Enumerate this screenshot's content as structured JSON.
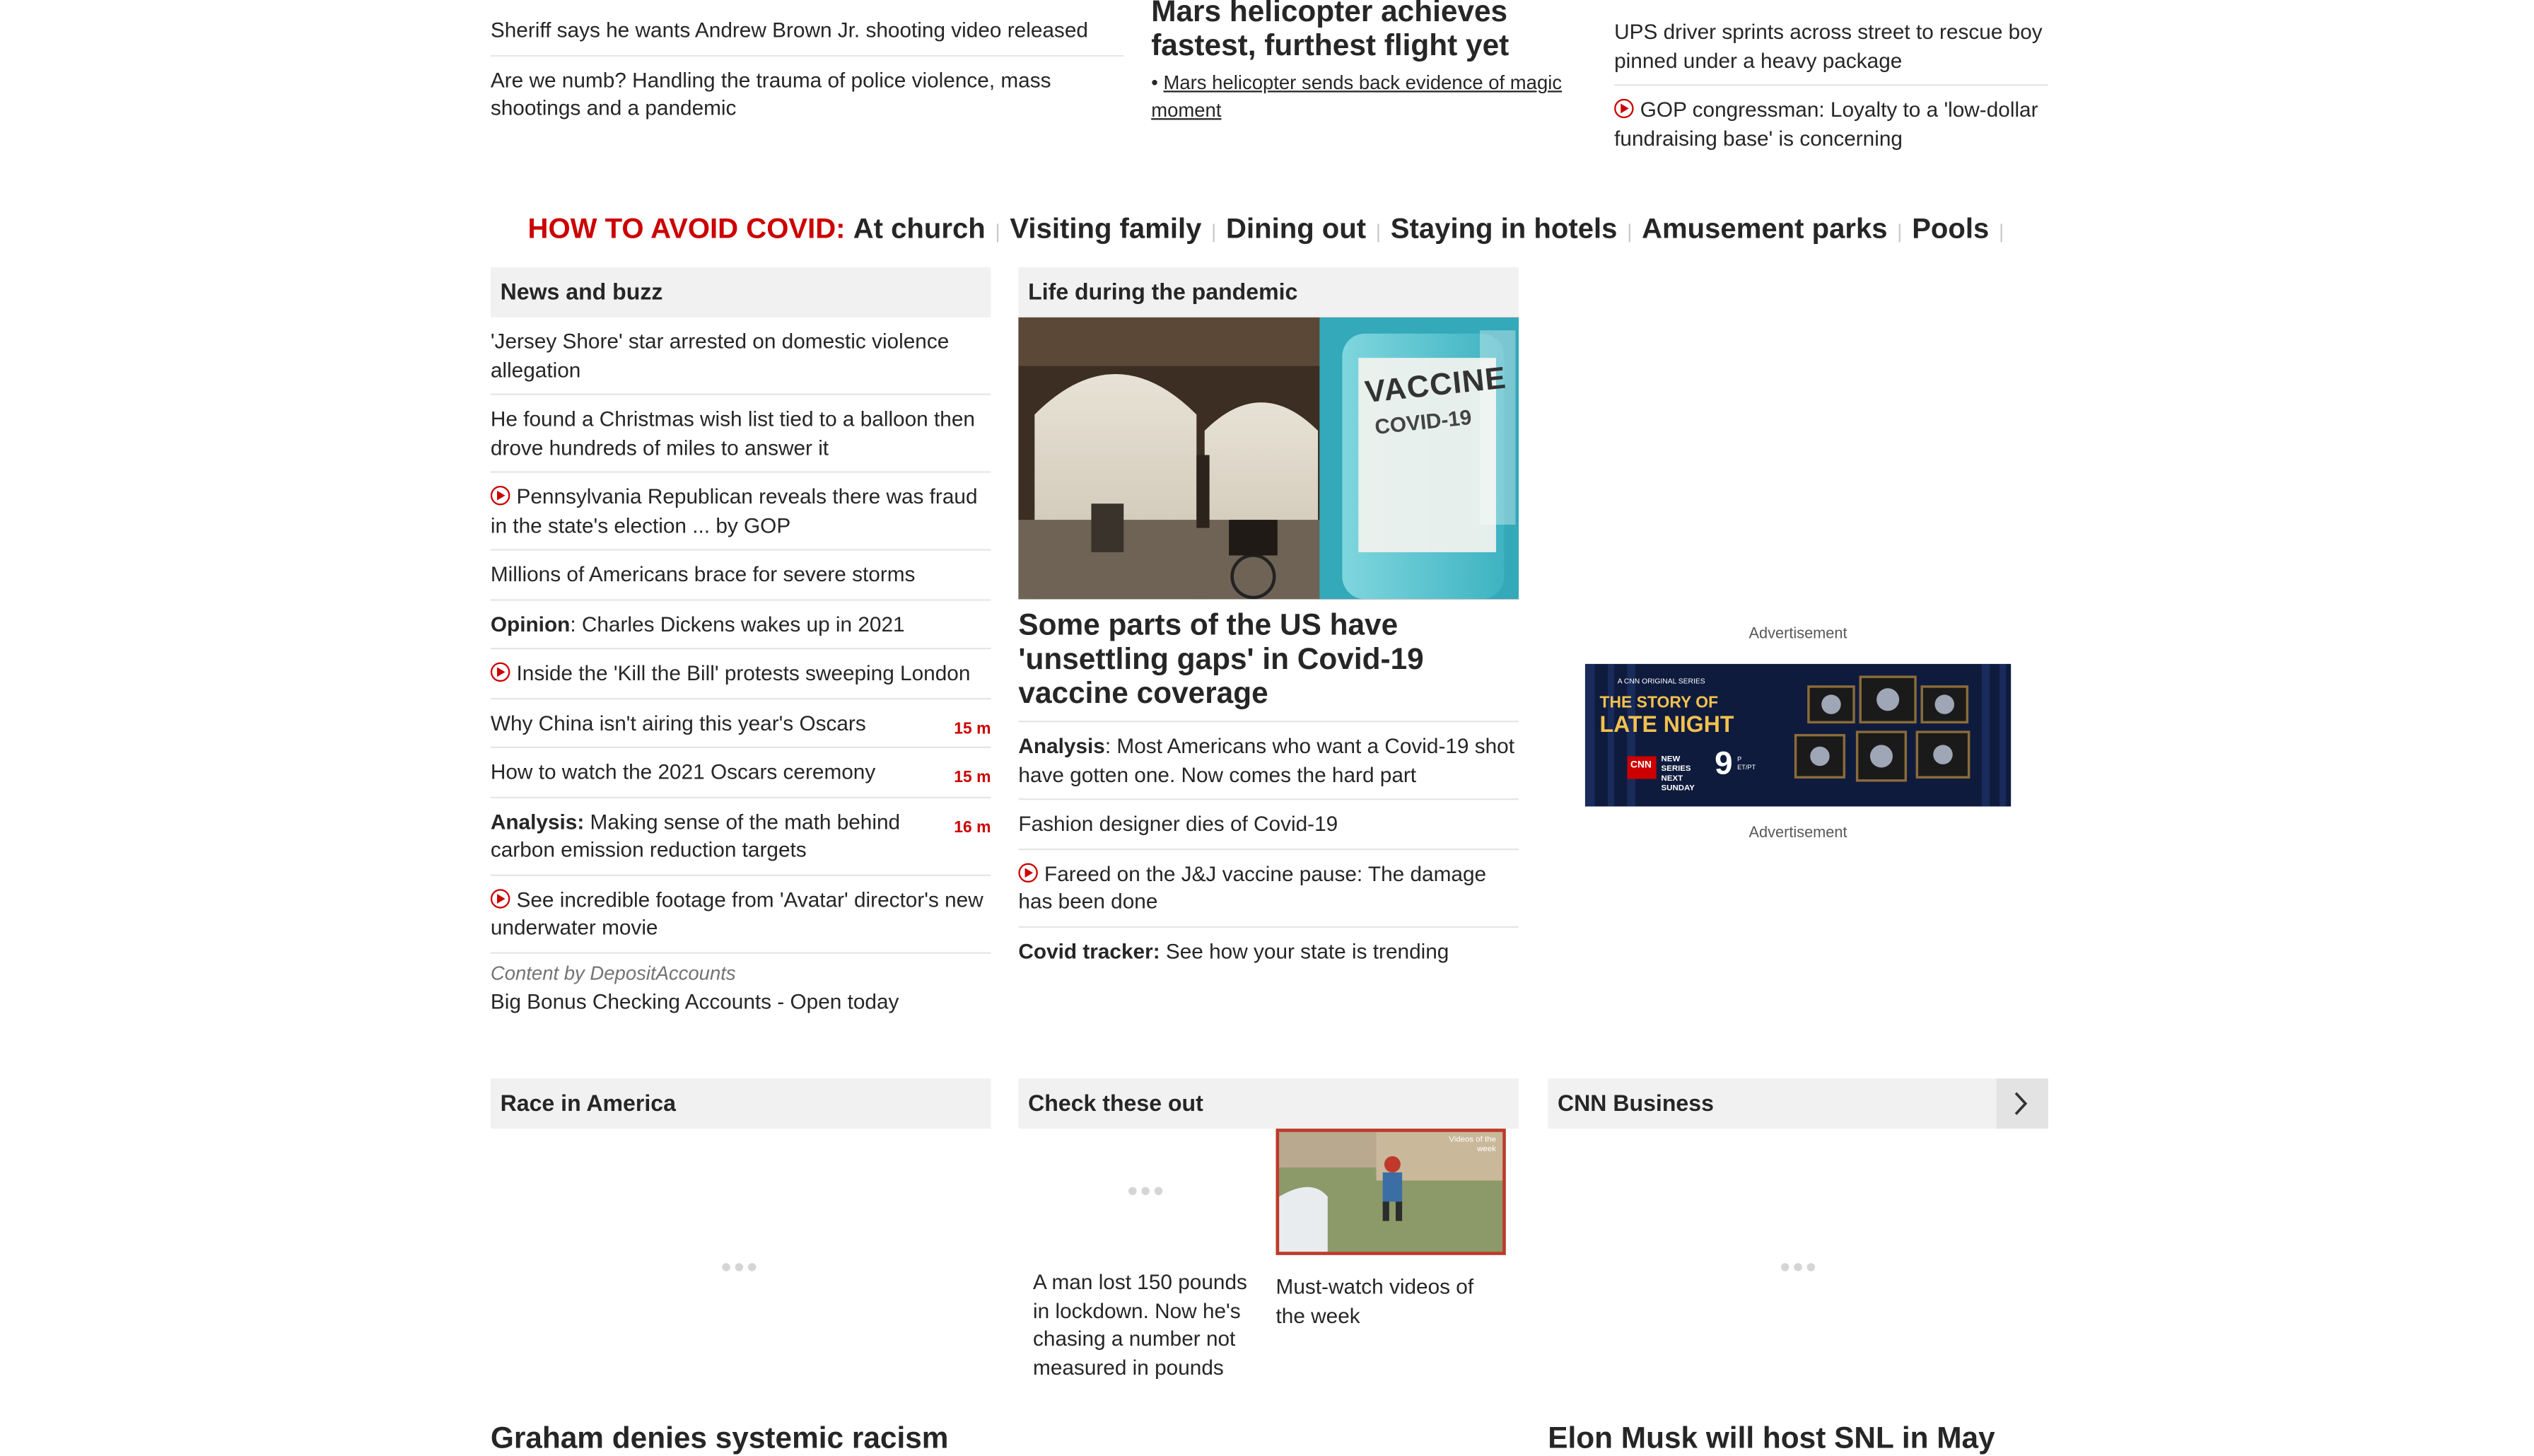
{
  "top_left": [
    "Sheriff says he wants Andrew Brown Jr. shooting video released",
    "Are we numb? Handling the trauma of police violence, mass shootings and a pandemic"
  ],
  "top_middle": {
    "headline": "Mars helicopter achieves fastest, furthest flight yet",
    "sub": "Mars helicopter sends back evidence of magic moment"
  },
  "top_right": [
    "UPS driver sprints across street to rescue boy pinned under a heavy package",
    "GOP congressman: Loyalty to a 'low-dollar fundraising base' is concerning"
  ],
  "covid_bar": {
    "label": "HOW TO AVOID COVID:",
    "items": [
      "At church",
      "Visiting family",
      "Dining out",
      "Staying in hotels",
      "Amusement parks",
      "Pools"
    ]
  },
  "news_buzz": {
    "title": "News and buzz",
    "items": [
      {
        "text": "'Jersey Shore' star arrested on domestic violence allegation"
      },
      {
        "text": "He found a Christmas wish list tied to a balloon then drove hundreds of miles to answer it"
      },
      {
        "text": "Pennsylvania Republican reveals there was fraud in the state's election ... by GOP"
      },
      {
        "text": "Millions of Americans brace for severe storms"
      },
      {
        "prefix": "Opinion",
        "text": ": Charles Dickens wakes up in 2021"
      },
      {
        "text": "Inside the 'Kill the Bill' protests sweeping London"
      },
      {
        "text": "Why China isn't airing this year's Oscars",
        "time": "15 m"
      },
      {
        "text": "How to watch the 2021 Oscars ceremony",
        "time": "15 m"
      },
      {
        "prefix": "Analysis:",
        "text": " Making sense of the math behind carbon emission reduction targets",
        "time": "16 m"
      },
      {
        "text": "See incredible footage from 'Avatar' director's new underwater movie"
      }
    ],
    "sponsor_by": "Content by DepositAccounts",
    "sponsor_text": "Big Bonus Checking Accounts - Open today"
  },
  "pandemic": {
    "title": "Life during the pandemic",
    "image_text_1": "VACCINE",
    "image_text_2": "COVID-19",
    "headline": "Some parts of the US have 'unsettling gaps' in Covid-19 vaccine coverage",
    "items": [
      {
        "prefix": "Analysis",
        "text": ": Most Americans who want a Covid-19 shot have gotten one. Now comes the hard part"
      },
      {
        "text": "Fashion designer dies of Covid-19"
      },
      {
        "text": "Fareed on the J&J vaccine pause: The damage has been done"
      },
      {
        "prefix": "Covid tracker:",
        "text": " See how your state is trending"
      }
    ]
  },
  "ad": {
    "label_top": "Advertisement",
    "label_bottom": "Advertisement",
    "banner_small": "A CNN ORIGINAL SERIES",
    "banner_title_1": "THE STORY OF",
    "banner_title_2": "LATE NIGHT",
    "banner_logo": "CNN",
    "banner_when": "NEW SERIES NEXT SUNDAY",
    "banner_time": "9",
    "banner_tz": "P ET/PT"
  },
  "race": {
    "title": "Race in America",
    "headline": "Graham denies systemic racism"
  },
  "check": {
    "title": "Check these out",
    "left_text": "A man lost 150 pounds in lockdown. Now he's chasing a number not measured in pounds",
    "right_text": "Must-watch videos of the week",
    "thumb_label": "Videos of the week"
  },
  "business": {
    "title": "CNN Business",
    "headline": "Elon Musk will host SNL in May"
  },
  "colors": {
    "accent": "#cc0000",
    "header_bg": "#f1f1f1"
  }
}
